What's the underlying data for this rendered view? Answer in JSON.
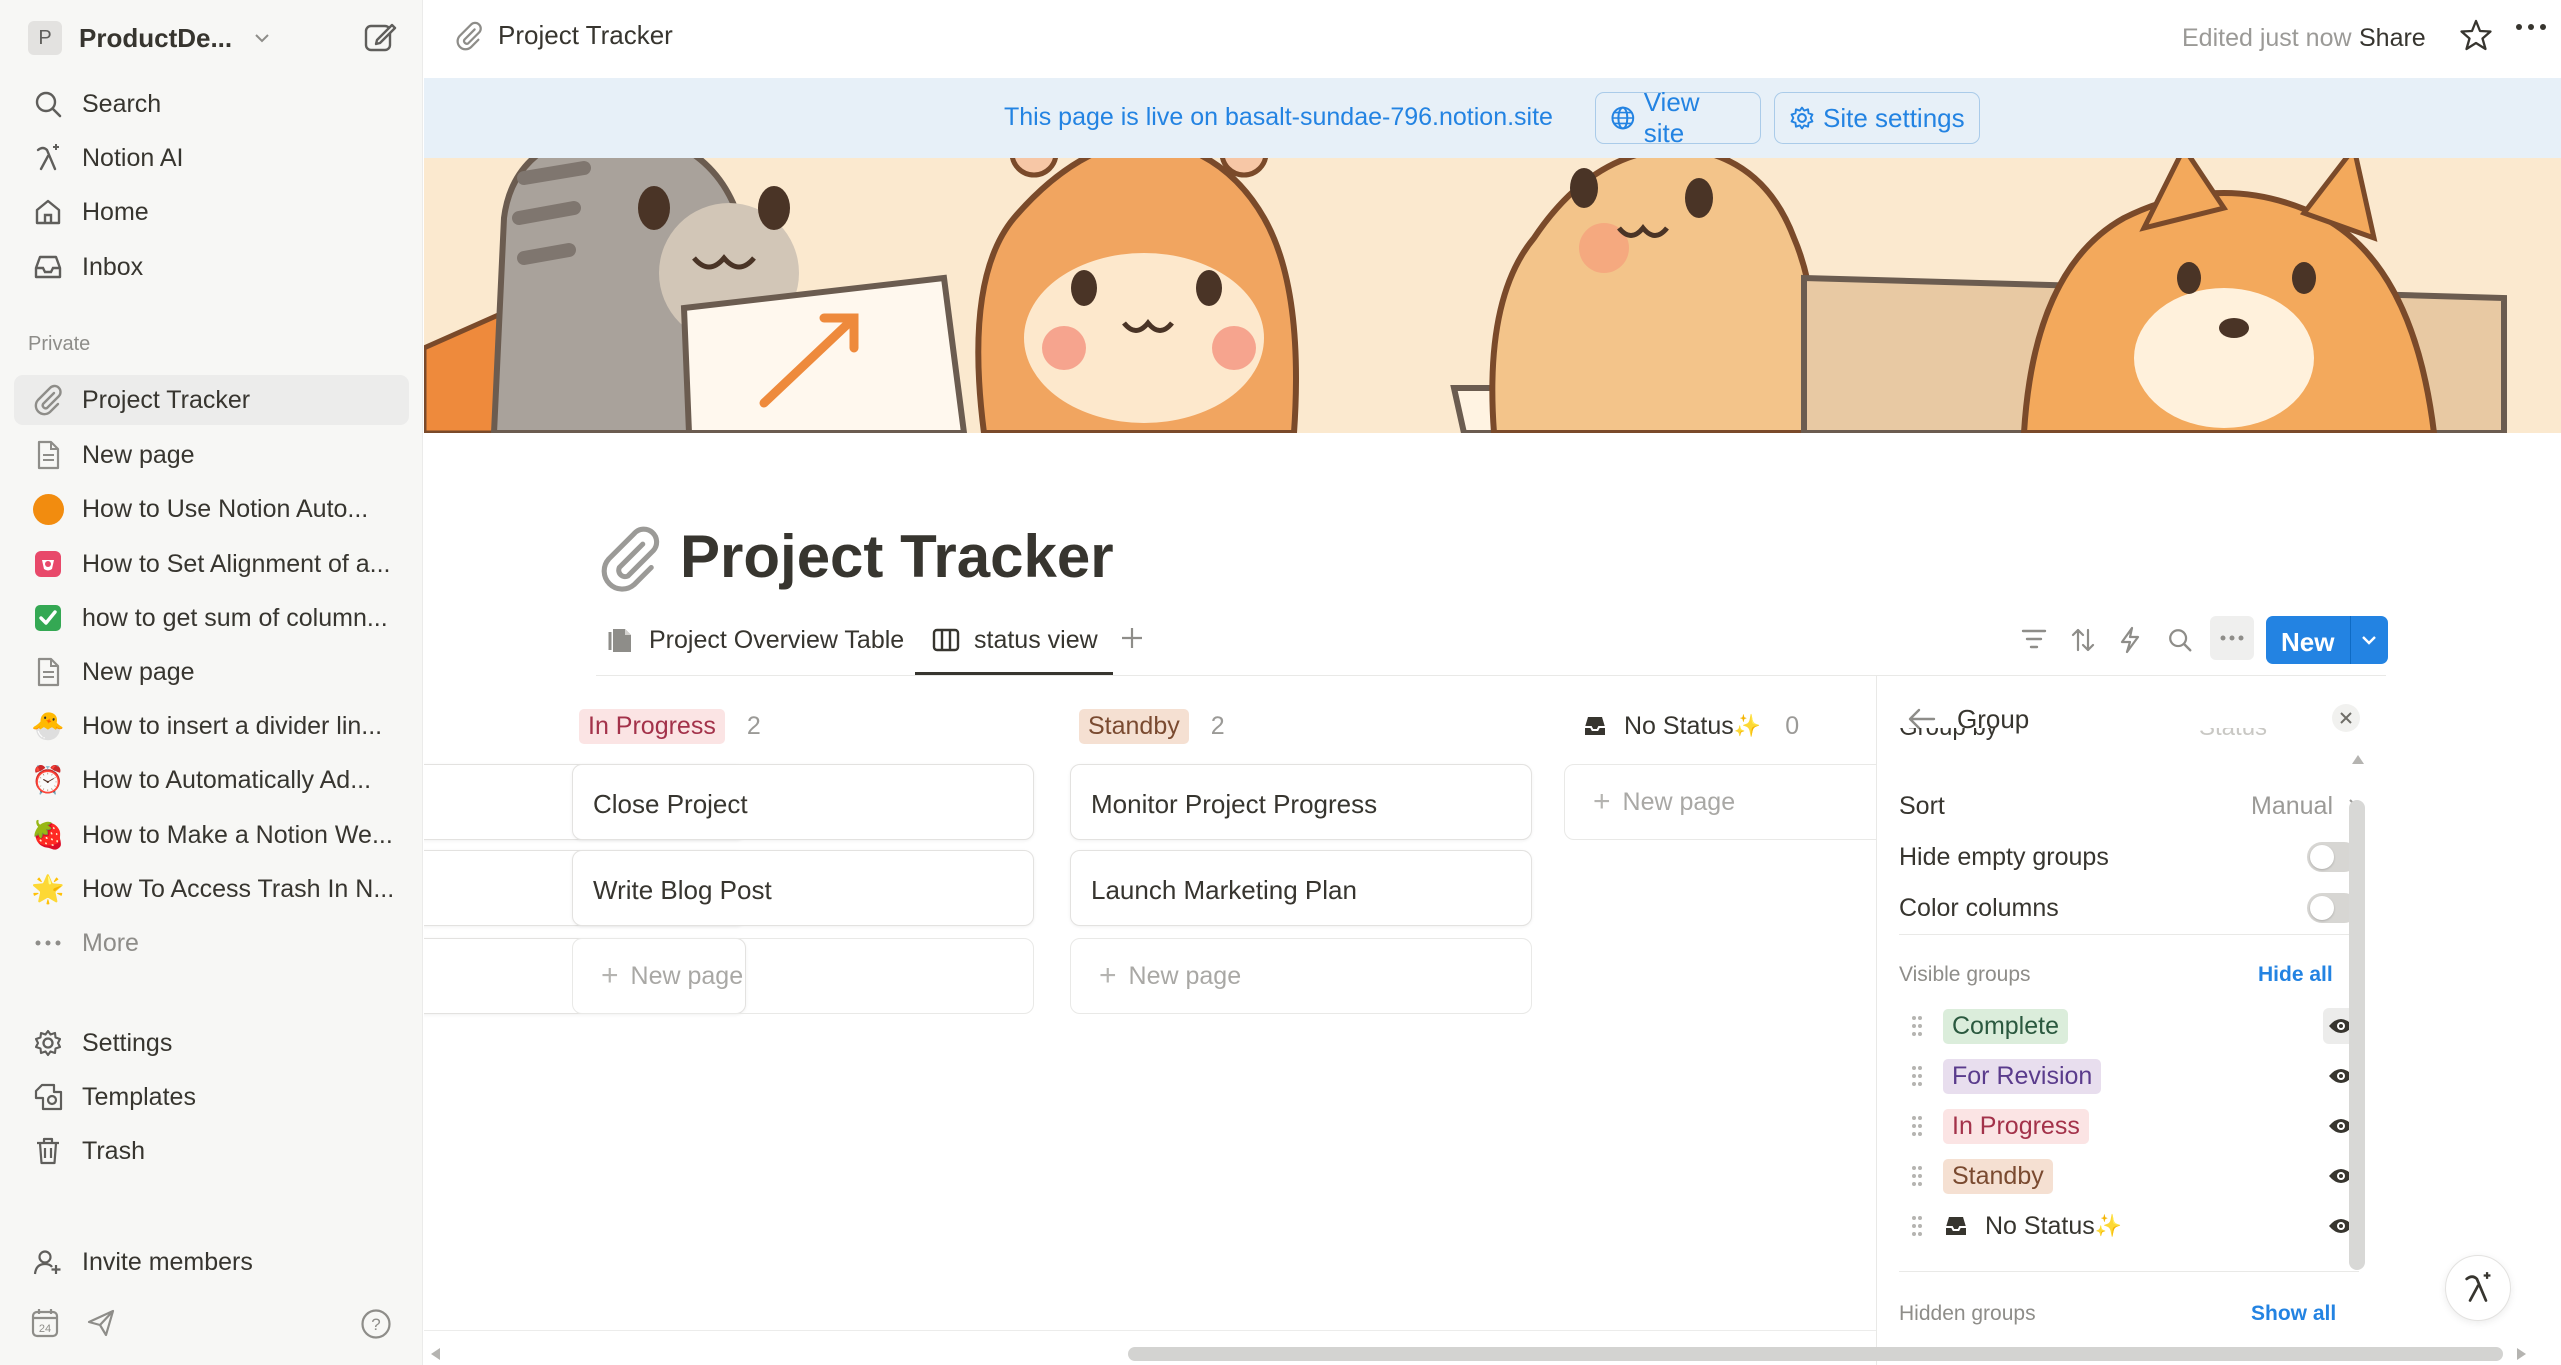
{
  "sidebar": {
    "workspace": {
      "badge": "P",
      "name": "ProductDe..."
    },
    "nav": [
      {
        "label": "Search",
        "icon": "search-icon"
      },
      {
        "label": "Notion AI",
        "icon": "notion-ai-icon"
      },
      {
        "label": "Home",
        "icon": "home-icon"
      },
      {
        "label": "Inbox",
        "icon": "inbox-icon"
      }
    ],
    "section_label": "Private",
    "pages": [
      {
        "label": "Project Tracker",
        "icon": "paperclip-icon"
      },
      {
        "label": "New page",
        "icon": "page-icon"
      },
      {
        "label": "How to Use Notion Auto...",
        "icon": "orange-circle-icon"
      },
      {
        "label": "How to Set Alignment of a...",
        "icon": "pink-square-icon"
      },
      {
        "label": "how to get sum of column...",
        "icon": "check-box-icon"
      },
      {
        "label": "New page",
        "icon": "page-icon"
      },
      {
        "label": "How to insert a divider lin...",
        "icon": "chick-icon",
        "emoji": "🐣"
      },
      {
        "label": "How to Automatically Ad...",
        "icon": "alarm-clock-icon",
        "emoji": "⏰"
      },
      {
        "label": "How to Make a Notion We...",
        "icon": "strawberry-icon",
        "emoji": "🍓"
      },
      {
        "label": "How To Access Trash In N...",
        "icon": "star-burst-icon",
        "emoji": "🌟"
      }
    ],
    "more_label": "More",
    "utility": [
      {
        "label": "Settings",
        "icon": "gear-icon"
      },
      {
        "label": "Templates",
        "icon": "templates-icon"
      },
      {
        "label": "Trash",
        "icon": "trash-icon"
      }
    ],
    "invite_label": "Invite members"
  },
  "topbar": {
    "breadcrumb": "Project Tracker",
    "edited": "Edited just now",
    "share": "Share"
  },
  "banner": {
    "text": "This page is live on basalt-sundae-796.notion.site",
    "view_site": "View site",
    "site_settings": "Site settings"
  },
  "page": {
    "title": "Project Tracker",
    "tabs": [
      {
        "label": "Project Overview Table",
        "icon": "table-icon"
      },
      {
        "label": "status view",
        "icon": "board-icon",
        "active": true
      }
    ],
    "new_button": "New"
  },
  "board": {
    "columns": [
      {
        "name": "In Progress",
        "count": "2",
        "color": "#fbe4e4",
        "text_color": "#a3324a",
        "cards": [
          "Close Project",
          "Write Blog Post"
        ]
      },
      {
        "name": "Standby",
        "count": "2",
        "color": "#f5e0d2",
        "text_color": "#7a4a30",
        "cards": [
          "Monitor Project Progress",
          "Launch Marketing Plan"
        ]
      },
      {
        "name": "No Status",
        "emoji": "✨",
        "count": "0",
        "cards": []
      }
    ],
    "new_page_label": "New page"
  },
  "group_panel": {
    "title": "Group",
    "cut_top_left": "Group by",
    "cut_top_right": "Status",
    "sort_label": "Sort",
    "sort_value": "Manual",
    "hide_empty_label": "Hide empty groups",
    "color_columns_label": "Color columns",
    "visible_groups_label": "Visible groups",
    "hide_all": "Hide all",
    "groups": [
      {
        "name": "Complete",
        "bg": "#dbeddb",
        "fg": "#2b593f"
      },
      {
        "name": "For Revision",
        "bg": "#e8deee",
        "fg": "#5a3b8c"
      },
      {
        "name": "In Progress",
        "bg": "#fbe4e4",
        "fg": "#a3324a"
      },
      {
        "name": "Standby",
        "bg": "#f5e0d2",
        "fg": "#7a4a30"
      },
      {
        "name": "No Status",
        "emoji": "✨"
      }
    ],
    "hidden_groups_label": "Hidden groups",
    "show_all": "Show all"
  },
  "colors": {
    "accent": "#2383e2",
    "banner_bg": "#e7f0f8"
  }
}
